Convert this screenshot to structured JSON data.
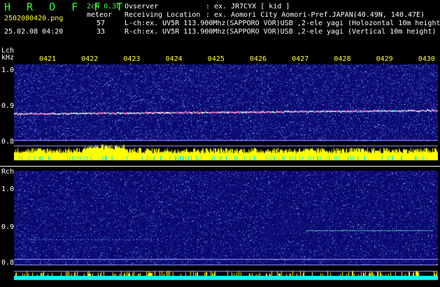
{
  "header": {
    "app_title": "H R O F F T",
    "file_name": "2502080420.png",
    "timestamp": "25.02.08 04:20",
    "channel_mode": "2ch 0.30",
    "detection_label": "meteor",
    "lch_count": "57",
    "rch_count": "33",
    "observer_label": "Ovserver",
    "observer_value": ": ex. JR7CYX [ kid ]",
    "location_label": "Receiving Location",
    "location_value": ": ex. Aomori City Aomori-Pref.JAPAN(40.49N, 140.47E)",
    "lch_info": "L-ch:ex. UV5R 113.900Mhz(SAPPORO VOR)USB ,2-ele yagi (Holozontal 10m height)",
    "rch_info": "R-ch:ex. UV5R 113.900Mhz(SAPPORO VOR)USB ,2-ele yagi (Vertical 10m height)"
  },
  "lch": {
    "label": "Lch",
    "unit": "kHz",
    "ticks": [
      "1.0",
      "0.9",
      "0.8"
    ]
  },
  "rch": {
    "label": "Rch",
    "ticks": [
      "1.0",
      "0.9",
      "0.8"
    ]
  },
  "time_labels": [
    "0421",
    "0422",
    "0423",
    "0424",
    "0425",
    "0426",
    "0427",
    "0428",
    "0429",
    "0430"
  ],
  "colors": {
    "background": "#000000",
    "title": "#33ff33",
    "time_labels": "#ffff33",
    "count_numbers": "#ffffff",
    "spectrum_bg": "#0a0a6e",
    "signal_line": "#ff66cc",
    "level_bar": "#ffff00",
    "level_base": "#00ffff",
    "reference_line": "#9999ff"
  }
}
